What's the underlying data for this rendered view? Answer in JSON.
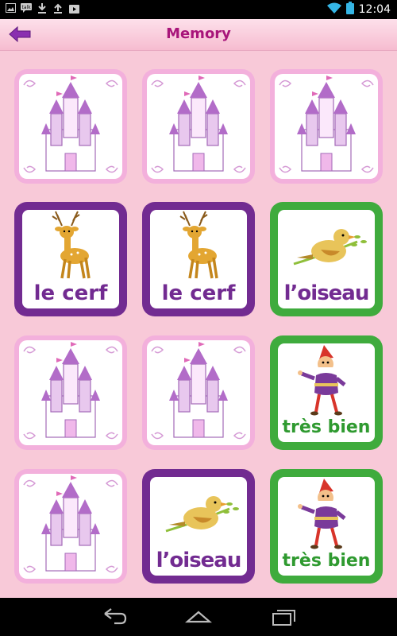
{
  "status_bar": {
    "time": "12:04",
    "icons": [
      "image-icon",
      "talk-icon",
      "download-icon",
      "upload-icon",
      "play-store-icon",
      "wifi-icon",
      "battery-icon"
    ]
  },
  "app_bar": {
    "title": "Memory",
    "back_icon": "back-arrow-icon"
  },
  "colors": {
    "background": "#f8c9d8",
    "title": "#a8157a",
    "card_back_border": "#f3b0dc",
    "purple": "#722b91",
    "green": "#3fab3d"
  },
  "board": {
    "rows": 4,
    "columns": 3,
    "cards": [
      {
        "state": "hidden",
        "picture": "castle"
      },
      {
        "state": "hidden",
        "picture": "castle"
      },
      {
        "state": "hidden",
        "picture": "castle"
      },
      {
        "state": "revealed",
        "picture": "deer",
        "word": "le cerf",
        "color": "purple"
      },
      {
        "state": "revealed",
        "picture": "deer",
        "word": "le cerf",
        "color": "purple"
      },
      {
        "state": "revealed",
        "picture": "bird",
        "word": "l’oiseau",
        "color": "green"
      },
      {
        "state": "hidden",
        "picture": "castle"
      },
      {
        "state": "hidden",
        "picture": "castle"
      },
      {
        "state": "revealed",
        "picture": "gnome",
        "word": "très bien",
        "color": "green"
      },
      {
        "state": "hidden",
        "picture": "castle"
      },
      {
        "state": "revealed",
        "picture": "bird",
        "word": "l’oiseau",
        "color": "purple"
      },
      {
        "state": "revealed",
        "picture": "gnome",
        "word": "très bien",
        "color": "green"
      }
    ]
  },
  "nav_bar": {
    "buttons": [
      "back-nav-icon",
      "home-nav-icon",
      "recents-nav-icon"
    ]
  }
}
